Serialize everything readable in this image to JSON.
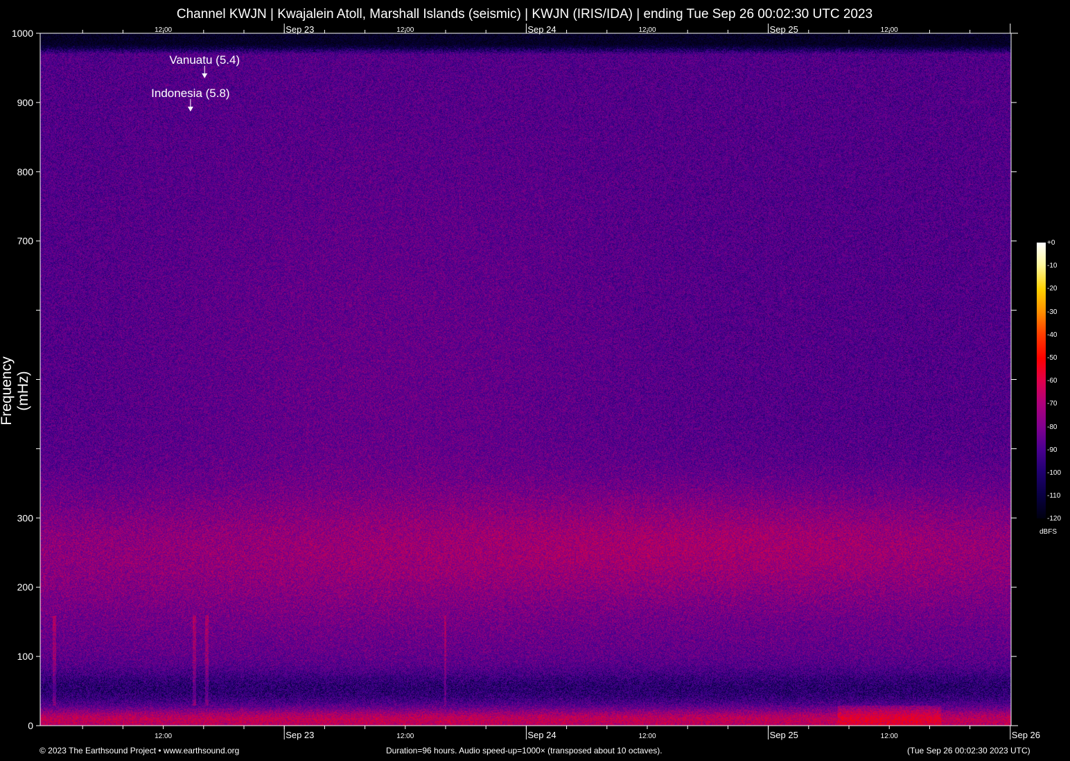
{
  "title": "Channel KWJN | Kwajalein Atoll, Marshall Islands (seismic) | KWJN (IRIS/IDA) | ending Tue Sep 26 00:02:30 UTC 2023",
  "footer": {
    "copyright": "© 2023 The Earthsound Project • www.earthsound.org",
    "info": "Duration=96 hours. Audio speed-up=1000× (transposed about 10 octaves).",
    "end_time": "(Tue Sep 26 00:02:30 2023 UTC)"
  },
  "chart_data": {
    "type": "heatmap",
    "title": "Channel KWJN | Kwajalein Atoll, Marshall Islands (seismic) | KWJN (IRIS/IDA) | ending Tue Sep 26 00:02:30 UTC 2023",
    "ylabel": "Frequency (mHz)",
    "xlabel": "",
    "ylim": [
      0,
      1000
    ],
    "xlim_hours": [
      0,
      96
    ],
    "y_ticks": [
      {
        "value": 0,
        "label": "0"
      },
      {
        "value": 100,
        "label": "100"
      },
      {
        "value": 200,
        "label": "200"
      },
      {
        "value": 300,
        "label": "300"
      },
      {
        "value": 400,
        "label": ""
      },
      {
        "value": 500,
        "label": ""
      },
      {
        "value": 600,
        "label": ""
      },
      {
        "value": 700,
        "label": "700"
      },
      {
        "value": 800,
        "label": "800"
      },
      {
        "value": 900,
        "label": "900"
      },
      {
        "value": 1000,
        "label": "1000"
      }
    ],
    "x_ticks": [
      {
        "hour": 12,
        "label": "12:00",
        "major": false
      },
      {
        "hour": 24,
        "label": "Sep 23",
        "major": true
      },
      {
        "hour": 36,
        "label": "12:00",
        "major": false
      },
      {
        "hour": 48,
        "label": "Sep 24",
        "major": true
      },
      {
        "hour": 60,
        "label": "12:00",
        "major": false
      },
      {
        "hour": 72,
        "label": "Sep 25",
        "major": true
      },
      {
        "hour": 84,
        "label": "12:00",
        "major": false
      },
      {
        "hour": 96,
        "label": "Sep 26",
        "major": true
      }
    ],
    "annotations": [
      {
        "label": "Vanuatu (5.4)",
        "hour": 16.1,
        "freq": 935
      },
      {
        "label": "Indonesia (5.8)",
        "hour": 14.7,
        "freq": 887
      }
    ],
    "colorbar": {
      "label": "dBFS",
      "range": [
        -120,
        0
      ],
      "ticks": [
        "+0",
        "-10",
        "-20",
        "-30",
        "-40",
        "-50",
        "-60",
        "-70",
        "-80",
        "-90",
        "-100",
        "-110",
        "-120"
      ]
    }
  }
}
